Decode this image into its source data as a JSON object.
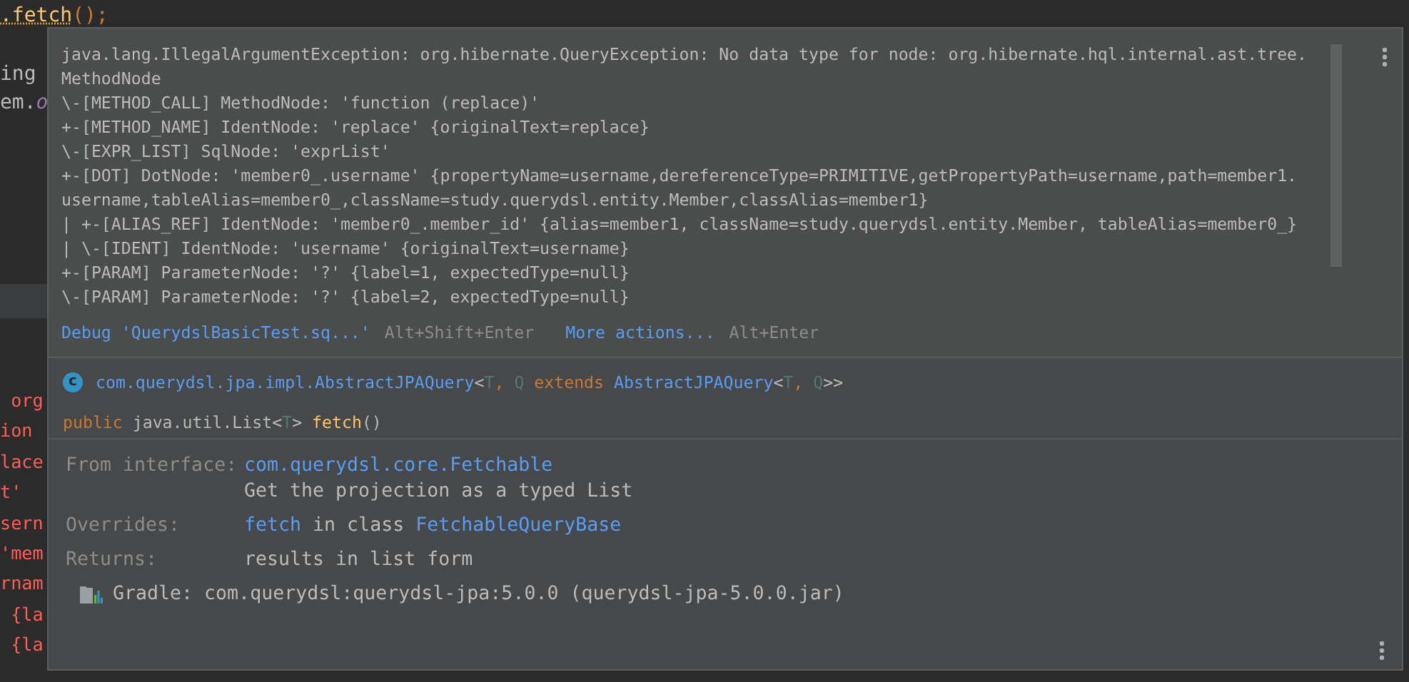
{
  "editor": {
    "top_line": [
      {
        "text": ".fetch",
        "kind": "warn"
      },
      {
        "text": "();",
        "kind": "punct"
      }
    ],
    "upper_fragments": [
      [
        {
          "text": "ing",
          "kind": "plain"
        }
      ],
      [
        {
          "text": "em.",
          "kind": "plain"
        },
        {
          "text": "o",
          "kind": "field"
        }
      ]
    ],
    "lower_fragments": [
      [
        {
          "text": " org",
          "kind": "error"
        }
      ],
      [
        {
          "text": "ion",
          "kind": "error"
        }
      ],
      [
        {
          "text": "lace",
          "kind": "error"
        }
      ],
      [
        {
          "text": "t'",
          "kind": "error"
        }
      ],
      [
        {
          "text": "sern",
          "kind": "error"
        }
      ],
      [
        {
          "text": "'mem",
          "kind": "error"
        }
      ],
      [
        {
          "text": "rnam",
          "kind": "error"
        }
      ],
      [
        {
          "text": " {la",
          "kind": "error"
        }
      ],
      [
        {
          "text": " {la",
          "kind": "error"
        }
      ]
    ]
  },
  "popup": {
    "error_lines": [
      "java.lang.IllegalArgumentException: org.hibernate.QueryException: No data type for node: org.hibernate.hql.internal.ast.tree.",
      "MethodNode",
      "\\-[METHOD_CALL] MethodNode: 'function (replace)'",
      "+-[METHOD_NAME] IdentNode: 'replace' {originalText=replace}",
      "\\-[EXPR_LIST] SqlNode: 'exprList'",
      "+-[DOT] DotNode: 'member0_.username' {propertyName=username,dereferenceType=PRIMITIVE,getPropertyPath=username,path=member1.",
      "username,tableAlias=member0_,className=study.querydsl.entity.Member,classAlias=member1}",
      "| +-[ALIAS_REF] IdentNode: 'member0_.member_id' {alias=member1, className=study.querydsl.entity.Member, tableAlias=member0_}",
      "| \\-[IDENT] IdentNode: 'username' {originalText=username}",
      "+-[PARAM] ParameterNode: '?' {label=1, expectedType=null}",
      "\\-[PARAM] ParameterNode: '?' {label=2, expectedType=null}"
    ],
    "actions": [
      {
        "label": "Debug 'QuerydslBasicTest.sq...'",
        "shortcut": "Alt+Shift+Enter"
      },
      {
        "label": "More actions...",
        "shortcut": "Alt+Enter"
      }
    ],
    "class_badge": "c",
    "class_signature": [
      {
        "text": "com.querydsl.jpa.impl.AbstractJPAQuery",
        "kind": "link"
      },
      {
        "text": "<",
        "kind": "plain"
      },
      {
        "text": "T",
        "kind": "param"
      },
      {
        "text": ", ",
        "kind": "keyword"
      },
      {
        "text": "Q",
        "kind": "param"
      },
      {
        "text": " extends ",
        "kind": "keyword"
      },
      {
        "text": "AbstractJPAQuery",
        "kind": "link"
      },
      {
        "text": "<",
        "kind": "plain"
      },
      {
        "text": "T",
        "kind": "param"
      },
      {
        "text": ", ",
        "kind": "keyword"
      },
      {
        "text": "Q",
        "kind": "param"
      },
      {
        "text": ">>",
        "kind": "plain"
      }
    ],
    "method_signature": [
      {
        "text": "public",
        "kind": "keyword"
      },
      {
        "text": " java.util.List<",
        "kind": "plain"
      },
      {
        "text": "T",
        "kind": "param"
      },
      {
        "text": "> ",
        "kind": "plain"
      },
      {
        "text": "fetch",
        "kind": "method"
      },
      {
        "text": "()",
        "kind": "plain"
      }
    ],
    "doc": [
      {
        "label": "From interface:",
        "lines": [
          [
            {
              "text": "com.querydsl.core.Fetchable",
              "kind": "link"
            }
          ],
          [
            {
              "text": "Get the projection as a typed List",
              "kind": "plain"
            }
          ]
        ]
      },
      {
        "label": "Overrides:",
        "lines": [
          [
            {
              "text": "fetch",
              "kind": "link"
            },
            {
              "text": " in class ",
              "kind": "plain"
            },
            {
              "text": "FetchableQueryBase",
              "kind": "link"
            }
          ]
        ]
      },
      {
        "label": "Returns:",
        "lines": [
          [
            {
              "text": "results in list form",
              "kind": "plain"
            }
          ]
        ]
      }
    ],
    "library": "Gradle: com.querydsl:querydsl-jpa:5.0.0 (querydsl-jpa-5.0.0.jar)"
  }
}
